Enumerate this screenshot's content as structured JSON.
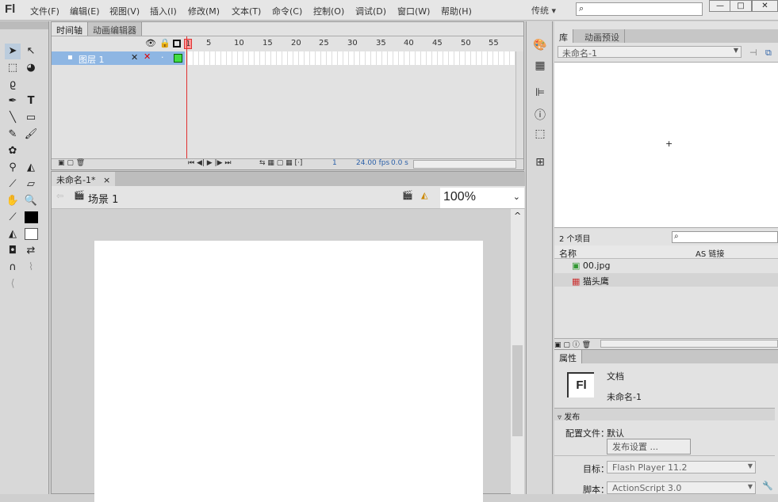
{
  "app": {
    "logo": "Fl",
    "menus": [
      "文件(F)",
      "编辑(E)",
      "视图(V)",
      "插入(I)",
      "修改(M)",
      "文本(T)",
      "命令(C)",
      "控制(O)",
      "调试(D)",
      "窗口(W)",
      "帮助(H)"
    ],
    "workspace": "传统 ▾",
    "search_placeholder": "",
    "window_buttons": [
      "—",
      "□",
      "✕"
    ]
  },
  "timeline": {
    "tabs": [
      "时间轴",
      "动画编辑器"
    ],
    "frame_numbers": [
      "1",
      "5",
      "10",
      "15",
      "20",
      "25",
      "30",
      "35",
      "40",
      "45",
      "50",
      "55"
    ],
    "layer_name": "图层 1",
    "current_frame": "1",
    "fps": "24.00 fps",
    "time": "0.0 s"
  },
  "document": {
    "tab": "未命名-1*",
    "close": "×",
    "scene": "场景 1",
    "zoom": "100%"
  },
  "library": {
    "tabs": [
      "库",
      "动画预设"
    ],
    "doc_select": "未命名-1",
    "count": "2 个项目",
    "col_name": "名称",
    "col_linkage": "AS 链接",
    "items": [
      "00.jpg",
      "猫头鹰"
    ]
  },
  "properties": {
    "tab": "属性",
    "doc_icon": "Fl",
    "doc_type": "文档",
    "doc_name": "未命名-1",
    "section": "发布",
    "profile_label": "配置文件：",
    "profile_value": "默认",
    "publish_settings": "发布设置 ...",
    "target_label": "目标：",
    "target_value": "Flash Player 11.2",
    "script_label": "脚本：",
    "script_value": "ActionScript 3.0"
  }
}
